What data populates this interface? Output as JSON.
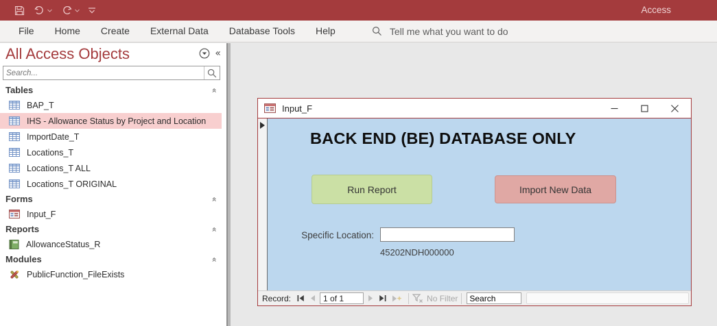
{
  "titlebar": {
    "app_label": "Access"
  },
  "ribbon": {
    "tabs": [
      "File",
      "Home",
      "Create",
      "External Data",
      "Database Tools",
      "Help"
    ],
    "tell_me": "Tell me what you want to do"
  },
  "nav_pane": {
    "title": "All Access Objects",
    "search_placeholder": "Search...",
    "sections": [
      {
        "label": "Tables",
        "items": [
          "BAP_T",
          "IHS - Allowance Status by Project and Location",
          "ImportDate_T",
          "Locations_T",
          "Locations_T ALL",
          "Locations_T ORIGINAL"
        ],
        "selected_index": 1
      },
      {
        "label": "Forms",
        "items": [
          "Input_F"
        ]
      },
      {
        "label": "Reports",
        "items": [
          "AllowanceStatus_R"
        ]
      },
      {
        "label": "Modules",
        "items": [
          "PublicFunction_FileExists"
        ]
      }
    ]
  },
  "form_window": {
    "title": "Input_F",
    "heading": "BACK END (BE) DATABASE ONLY",
    "run_report_label": "Run Report",
    "import_label": "Import New Data",
    "location_label": "Specific Location:",
    "location_value": "",
    "location_code": "45202NDH000000",
    "record_bar": {
      "label": "Record:",
      "position": "1 of 1",
      "no_filter": "No Filter",
      "search": "Search"
    }
  },
  "icons": {
    "quick_access": [
      "save-icon",
      "undo-icon",
      "redo-icon",
      "customize-quick-access-icon"
    ],
    "nav_item_types": [
      "table-icon",
      "form-icon",
      "report-icon",
      "module-icon"
    ]
  },
  "colors": {
    "titlebar": "#A43B3D",
    "accent": "#A43B3D",
    "selected_item_bg": "#F8CFCF",
    "form_canvas": "#BCD7EE",
    "run_button": "#CBE0A5",
    "import_button": "#E0A8A4",
    "ribbon_bg": "#F3F2F1",
    "main_bg": "#E8E8E8"
  }
}
